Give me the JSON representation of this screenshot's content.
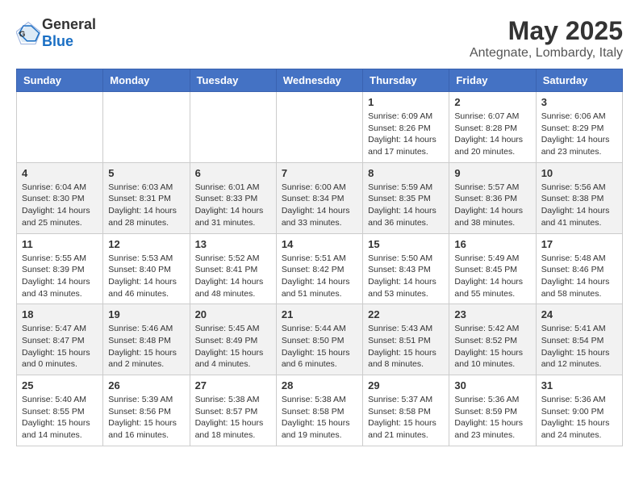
{
  "header": {
    "logo_general": "General",
    "logo_blue": "Blue",
    "month_year": "May 2025",
    "location": "Antegnate, Lombardy, Italy"
  },
  "weekdays": [
    "Sunday",
    "Monday",
    "Tuesday",
    "Wednesday",
    "Thursday",
    "Friday",
    "Saturday"
  ],
  "weeks": [
    [
      {
        "day": "",
        "info": ""
      },
      {
        "day": "",
        "info": ""
      },
      {
        "day": "",
        "info": ""
      },
      {
        "day": "",
        "info": ""
      },
      {
        "day": "1",
        "info": "Sunrise: 6:09 AM\nSunset: 8:26 PM\nDaylight: 14 hours\nand 17 minutes."
      },
      {
        "day": "2",
        "info": "Sunrise: 6:07 AM\nSunset: 8:28 PM\nDaylight: 14 hours\nand 20 minutes."
      },
      {
        "day": "3",
        "info": "Sunrise: 6:06 AM\nSunset: 8:29 PM\nDaylight: 14 hours\nand 23 minutes."
      }
    ],
    [
      {
        "day": "4",
        "info": "Sunrise: 6:04 AM\nSunset: 8:30 PM\nDaylight: 14 hours\nand 25 minutes."
      },
      {
        "day": "5",
        "info": "Sunrise: 6:03 AM\nSunset: 8:31 PM\nDaylight: 14 hours\nand 28 minutes."
      },
      {
        "day": "6",
        "info": "Sunrise: 6:01 AM\nSunset: 8:33 PM\nDaylight: 14 hours\nand 31 minutes."
      },
      {
        "day": "7",
        "info": "Sunrise: 6:00 AM\nSunset: 8:34 PM\nDaylight: 14 hours\nand 33 minutes."
      },
      {
        "day": "8",
        "info": "Sunrise: 5:59 AM\nSunset: 8:35 PM\nDaylight: 14 hours\nand 36 minutes."
      },
      {
        "day": "9",
        "info": "Sunrise: 5:57 AM\nSunset: 8:36 PM\nDaylight: 14 hours\nand 38 minutes."
      },
      {
        "day": "10",
        "info": "Sunrise: 5:56 AM\nSunset: 8:38 PM\nDaylight: 14 hours\nand 41 minutes."
      }
    ],
    [
      {
        "day": "11",
        "info": "Sunrise: 5:55 AM\nSunset: 8:39 PM\nDaylight: 14 hours\nand 43 minutes."
      },
      {
        "day": "12",
        "info": "Sunrise: 5:53 AM\nSunset: 8:40 PM\nDaylight: 14 hours\nand 46 minutes."
      },
      {
        "day": "13",
        "info": "Sunrise: 5:52 AM\nSunset: 8:41 PM\nDaylight: 14 hours\nand 48 minutes."
      },
      {
        "day": "14",
        "info": "Sunrise: 5:51 AM\nSunset: 8:42 PM\nDaylight: 14 hours\nand 51 minutes."
      },
      {
        "day": "15",
        "info": "Sunrise: 5:50 AM\nSunset: 8:43 PM\nDaylight: 14 hours\nand 53 minutes."
      },
      {
        "day": "16",
        "info": "Sunrise: 5:49 AM\nSunset: 8:45 PM\nDaylight: 14 hours\nand 55 minutes."
      },
      {
        "day": "17",
        "info": "Sunrise: 5:48 AM\nSunset: 8:46 PM\nDaylight: 14 hours\nand 58 minutes."
      }
    ],
    [
      {
        "day": "18",
        "info": "Sunrise: 5:47 AM\nSunset: 8:47 PM\nDaylight: 15 hours\nand 0 minutes."
      },
      {
        "day": "19",
        "info": "Sunrise: 5:46 AM\nSunset: 8:48 PM\nDaylight: 15 hours\nand 2 minutes."
      },
      {
        "day": "20",
        "info": "Sunrise: 5:45 AM\nSunset: 8:49 PM\nDaylight: 15 hours\nand 4 minutes."
      },
      {
        "day": "21",
        "info": "Sunrise: 5:44 AM\nSunset: 8:50 PM\nDaylight: 15 hours\nand 6 minutes."
      },
      {
        "day": "22",
        "info": "Sunrise: 5:43 AM\nSunset: 8:51 PM\nDaylight: 15 hours\nand 8 minutes."
      },
      {
        "day": "23",
        "info": "Sunrise: 5:42 AM\nSunset: 8:52 PM\nDaylight: 15 hours\nand 10 minutes."
      },
      {
        "day": "24",
        "info": "Sunrise: 5:41 AM\nSunset: 8:54 PM\nDaylight: 15 hours\nand 12 minutes."
      }
    ],
    [
      {
        "day": "25",
        "info": "Sunrise: 5:40 AM\nSunset: 8:55 PM\nDaylight: 15 hours\nand 14 minutes."
      },
      {
        "day": "26",
        "info": "Sunrise: 5:39 AM\nSunset: 8:56 PM\nDaylight: 15 hours\nand 16 minutes."
      },
      {
        "day": "27",
        "info": "Sunrise: 5:38 AM\nSunset: 8:57 PM\nDaylight: 15 hours\nand 18 minutes."
      },
      {
        "day": "28",
        "info": "Sunrise: 5:38 AM\nSunset: 8:58 PM\nDaylight: 15 hours\nand 19 minutes."
      },
      {
        "day": "29",
        "info": "Sunrise: 5:37 AM\nSunset: 8:58 PM\nDaylight: 15 hours\nand 21 minutes."
      },
      {
        "day": "30",
        "info": "Sunrise: 5:36 AM\nSunset: 8:59 PM\nDaylight: 15 hours\nand 23 minutes."
      },
      {
        "day": "31",
        "info": "Sunrise: 5:36 AM\nSunset: 9:00 PM\nDaylight: 15 hours\nand 24 minutes."
      }
    ]
  ]
}
